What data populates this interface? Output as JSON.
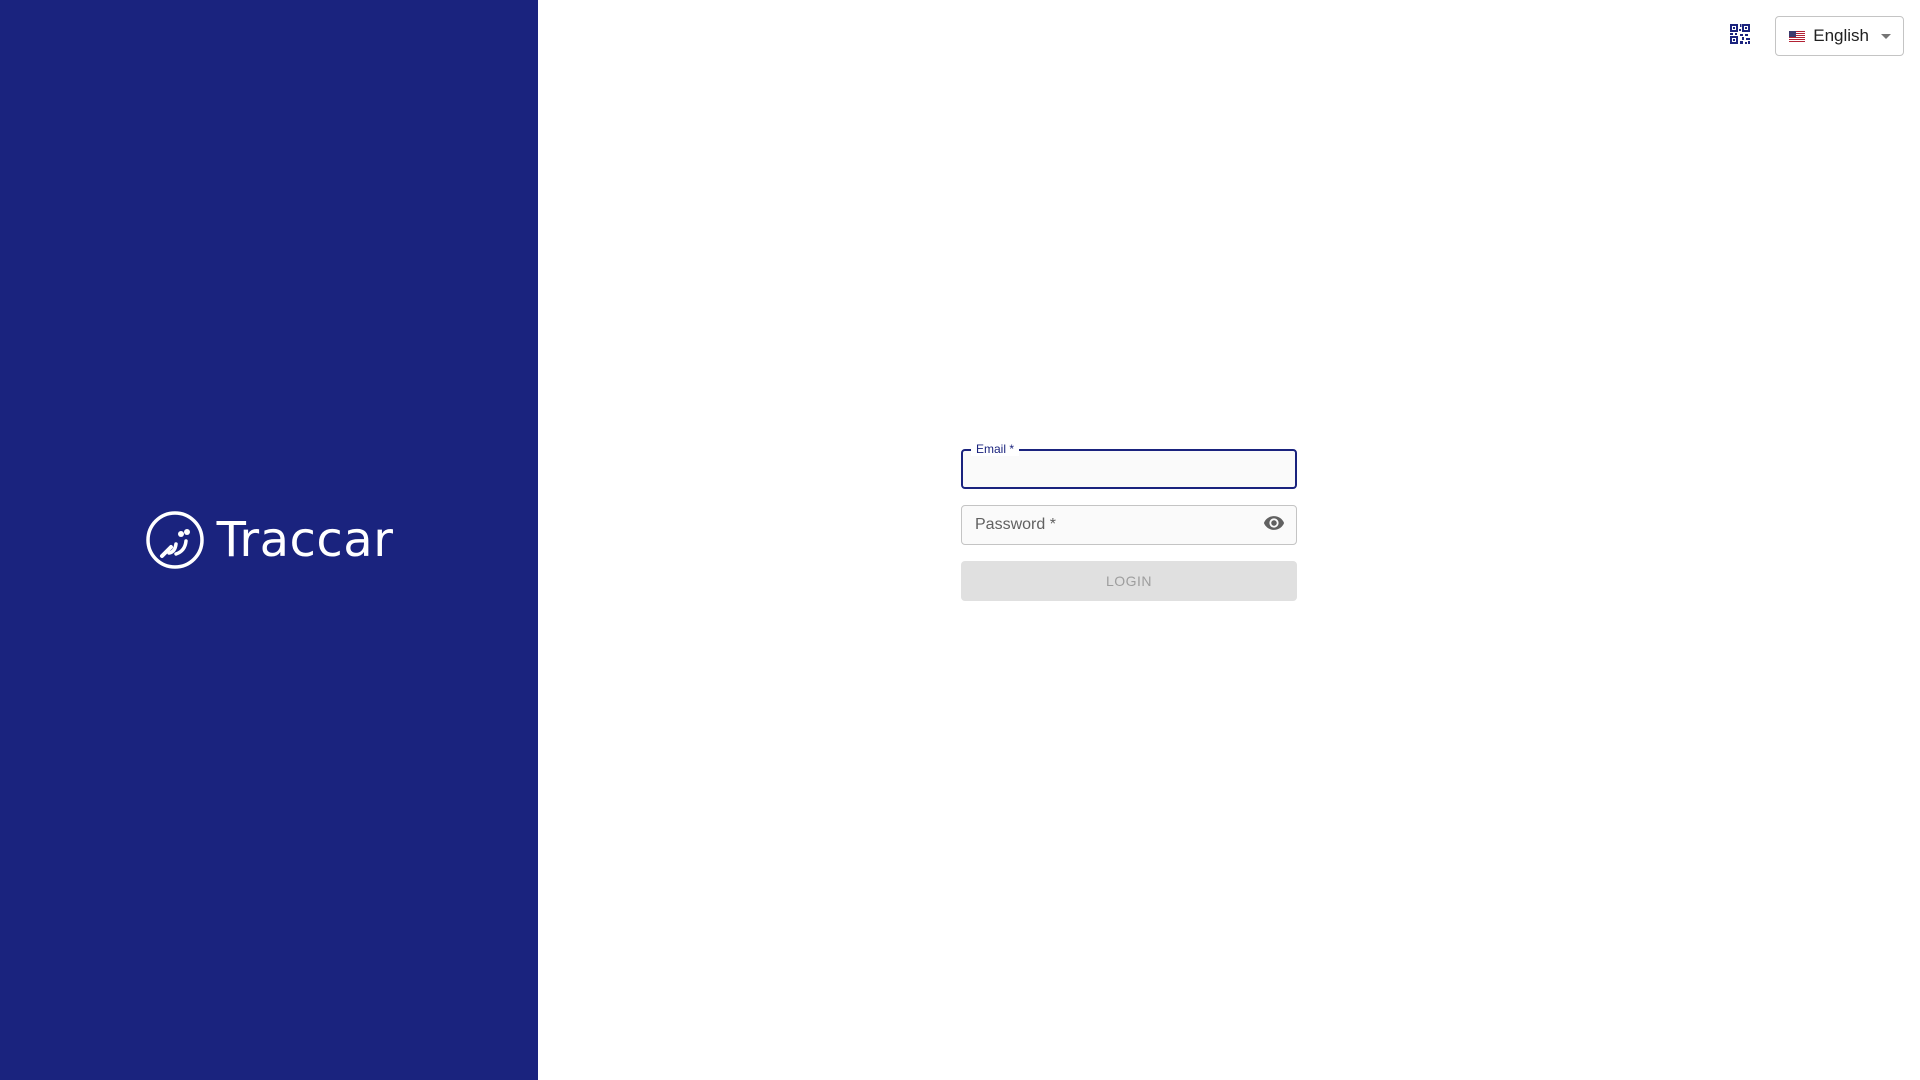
{
  "sidebar": {
    "brand_name": "Traccar",
    "background_color": "#1a237e",
    "logo_icon": "traccar-logo-icon"
  },
  "topbar": {
    "qr_icon": "qr-code-icon",
    "language": {
      "selected": "English",
      "flag_icon": "us-flag-icon",
      "dropdown_icon": "caret-down-icon"
    }
  },
  "login_form": {
    "email": {
      "label": "Email *",
      "value": ""
    },
    "password": {
      "label": "Password *",
      "value": "",
      "toggle_icon": "eye-icon"
    },
    "login_button_label": "LOGIN"
  },
  "colors": {
    "primary": "#1a237e",
    "disabled_button_bg": "#e0e0e0",
    "disabled_button_text": "#9e9e9e"
  }
}
